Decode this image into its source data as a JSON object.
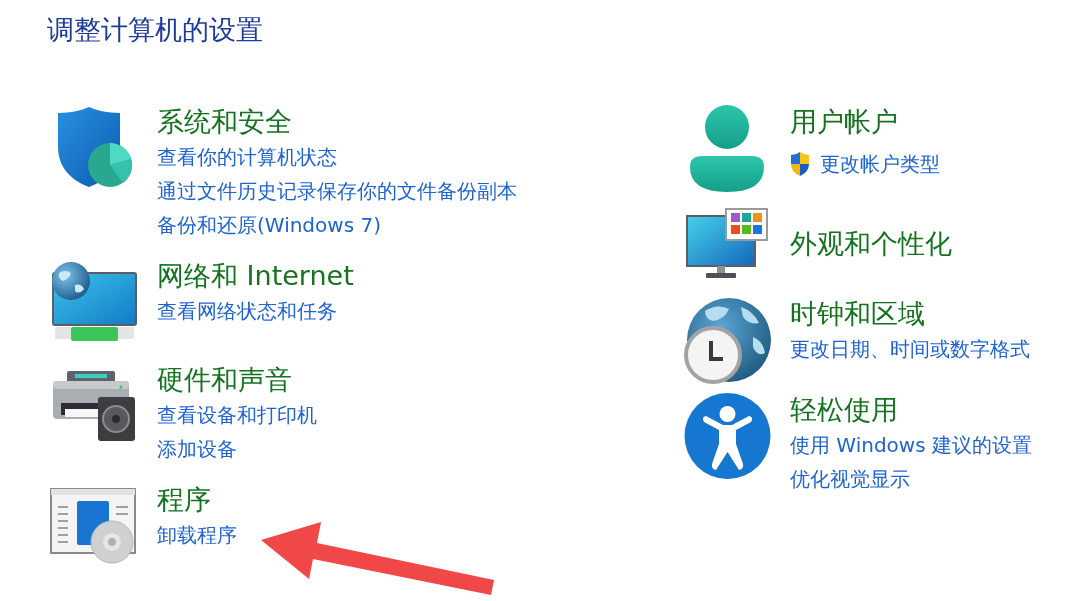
{
  "title": "调整计算机的设置",
  "columns": [
    {
      "categories": [
        {
          "title": "系统和安全",
          "links": [
            {
              "text": "查看你的计算机状态",
              "elevated": false
            },
            {
              "text": "通过文件历史记录保存你的文件备份副本",
              "elevated": false
            },
            {
              "text": "备份和还原(Windows 7)",
              "elevated": false
            }
          ]
        },
        {
          "title": "网络和 Internet",
          "links": [
            {
              "text": "查看网络状态和任务",
              "elevated": false
            }
          ]
        },
        {
          "title": "硬件和声音",
          "links": [
            {
              "text": "查看设备和打印机",
              "elevated": false
            },
            {
              "text": "添加设备",
              "elevated": false
            }
          ]
        },
        {
          "title": "程序",
          "links": [
            {
              "text": "卸载程序",
              "elevated": false
            }
          ]
        }
      ]
    },
    {
      "categories": [
        {
          "title": "用户帐户",
          "links": [
            {
              "text": "更改帐户类型",
              "elevated": true
            }
          ]
        },
        {
          "title": "外观和个性化"
        },
        {
          "title": "时钟和区域",
          "links": [
            {
              "text": "更改日期、时间或数字格式",
              "elevated": false
            }
          ]
        },
        {
          "title": "轻松使用",
          "links": [
            {
              "text": "使用 Windows 建议的设置",
              "elevated": false
            },
            {
              "text": "优化视觉显示",
              "elevated": false
            }
          ]
        }
      ]
    }
  ]
}
